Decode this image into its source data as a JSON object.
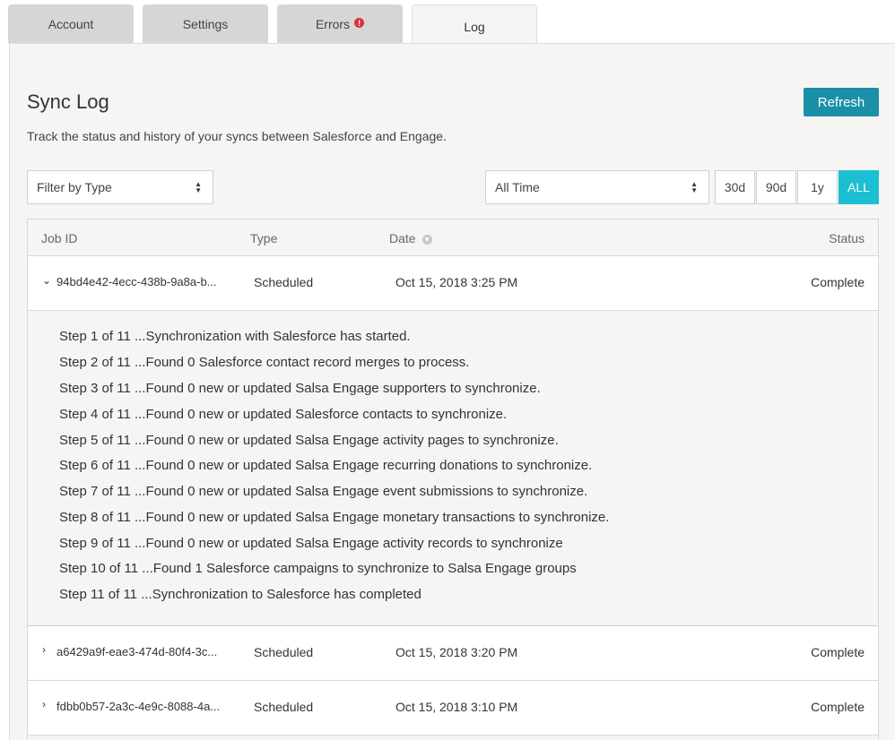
{
  "tabs": [
    {
      "label": "Account"
    },
    {
      "label": "Settings"
    },
    {
      "label": "Errors",
      "badge": "!"
    },
    {
      "label": "Log"
    }
  ],
  "header": {
    "title": "Sync Log",
    "subtitle": "Track the status and history of your syncs between Salesforce and Engage.",
    "refresh_label": "Refresh"
  },
  "filters": {
    "type_select": "Filter by Type",
    "time_select": "All Time",
    "ranges": [
      "30d",
      "90d",
      "1y",
      "ALL"
    ],
    "active_range": "ALL"
  },
  "table": {
    "columns": [
      "Job ID",
      "Type",
      "Date",
      "Status"
    ],
    "rows": [
      {
        "job_id": "94bd4e42-4ecc-438b-9a8a-b...",
        "type": "Scheduled",
        "date": "Oct 15, 2018 3:25 PM",
        "status": "Complete",
        "expanded": true
      },
      {
        "job_id": "a6429a9f-eae3-474d-80f4-3c...",
        "type": "Scheduled",
        "date": "Oct 15, 2018 3:20 PM",
        "status": "Complete",
        "expanded": false
      },
      {
        "job_id": "fdbb0b57-2a3c-4e9c-8088-4a...",
        "type": "Scheduled",
        "date": "Oct 15, 2018 3:10 PM",
        "status": "Complete",
        "expanded": false
      }
    ],
    "steps": [
      "Step 1 of 11 ...Synchronization with Salesforce has started.",
      "Step 2 of 11 ...Found 0 Salesforce contact record merges to process.",
      "Step 3 of 11 ...Found 0 new or updated Salsa Engage supporters to synchronize.",
      "Step 4 of 11 ...Found 0 new or updated Salesforce contacts to synchronize.",
      "Step 5 of 11 ...Found 0 new or updated Salsa Engage activity pages to synchronize.",
      "Step 6 of 11 ...Found 0 new or updated Salsa Engage recurring donations to synchronize.",
      "Step 7 of 11 ...Found 0 new or updated Salsa Engage event submissions to synchronize.",
      "Step 8 of 11 ...Found 0 new or updated Salsa Engage monetary transactions to synchronize.",
      "Step 9 of 11 ...Found 0 new or updated Salsa Engage activity records to synchronize",
      "Step 10 of 11 ...Found 1 Salesforce campaigns to synchronize to Salsa Engage groups",
      "Step 11 of 11 ...Synchronization to Salesforce has completed"
    ]
  },
  "colors": {
    "accent": "#1b8fa8",
    "active_range": "#1bbfd1",
    "error_badge": "#d9303a",
    "panel_bg": "#f6f5f3"
  }
}
